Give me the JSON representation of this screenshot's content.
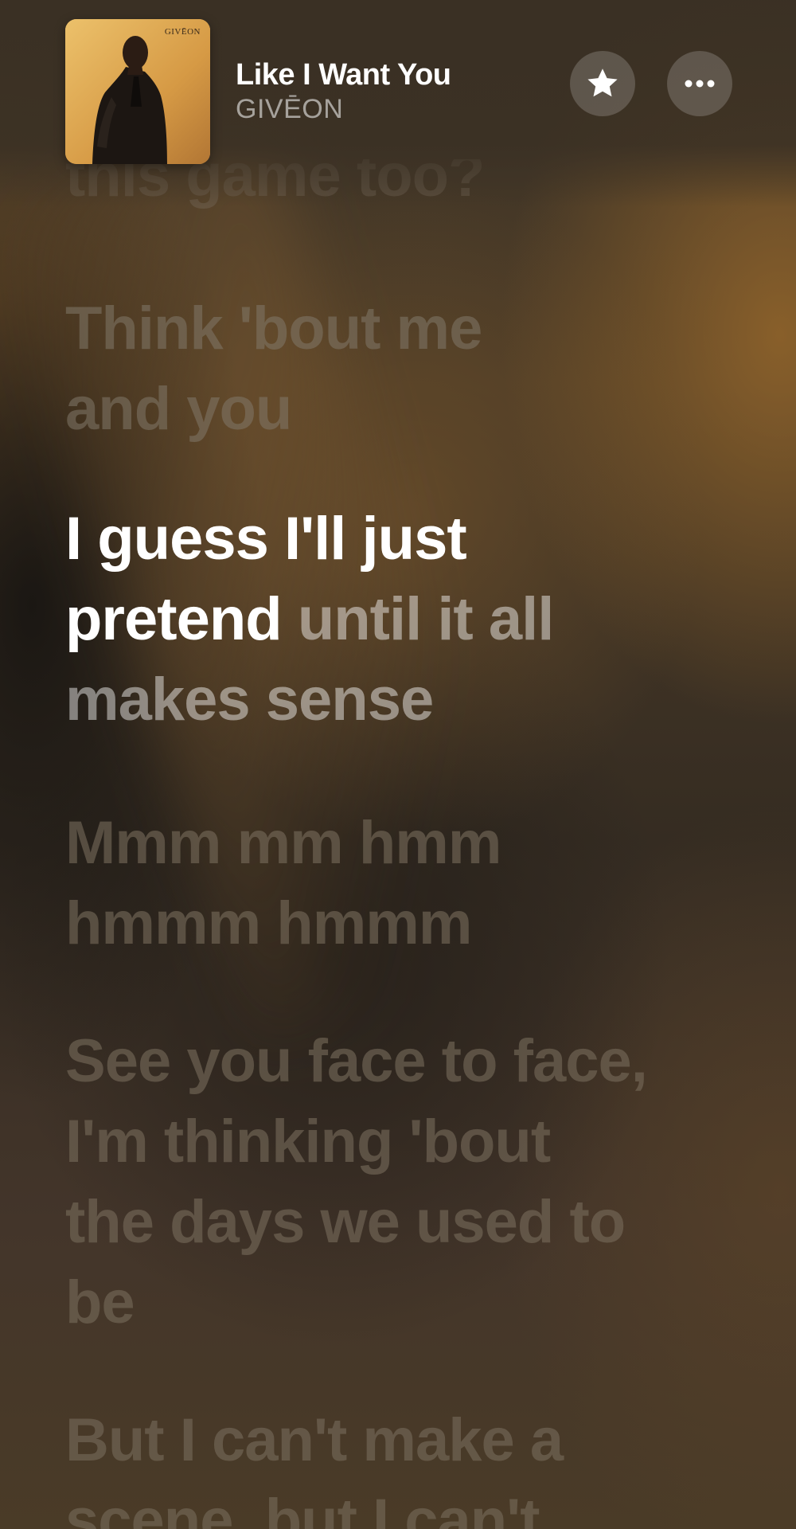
{
  "now_playing": {
    "title": "Like I Want You",
    "artist": "GIVĒON",
    "album_art_text": "GIVĒON"
  },
  "buttons": {
    "favorite_icon": "star-icon",
    "more_icon": "ellipsis-icon"
  },
  "lyrics": {
    "previous_partial": "this game too?",
    "previous": [
      "Think 'bout me",
      "and you"
    ],
    "current": {
      "sung_line1": "I guess I'll just",
      "sung_line2": "pretend",
      "unsung_line2": " until it all",
      "unsung_line3": "makes sense"
    },
    "upcoming": [
      [
        "Mmm mm hmm",
        "hmmm hmmm"
      ],
      [
        "See you face to face,",
        "I'm thinking 'bout",
        "the days we used to",
        "be"
      ],
      [
        "But I can't make a",
        "scene, but I can't"
      ]
    ]
  },
  "colors": {
    "background": "#3a3024",
    "active_text": "#ffffff",
    "accent": "#d79b45"
  }
}
